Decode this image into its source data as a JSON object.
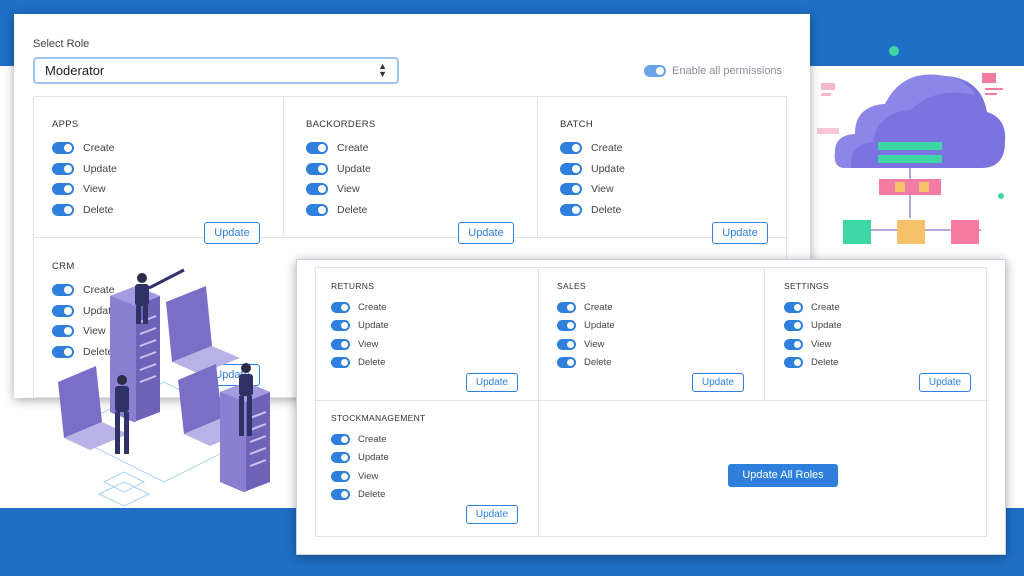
{
  "role_selector": {
    "label": "Select Role",
    "selected": "Moderator"
  },
  "enable_all": {
    "label": "Enable all permissions",
    "checked": true
  },
  "permission_labels": [
    "Create",
    "Update",
    "View",
    "Delete"
  ],
  "update_label": "Update",
  "modules_top": [
    {
      "name": "APPS"
    },
    {
      "name": "BACKORDERS"
    },
    {
      "name": "BATCH"
    },
    {
      "name": "CRM"
    }
  ],
  "modules_bottom": [
    {
      "name": "RETURNS"
    },
    {
      "name": "SALES"
    },
    {
      "name": "SETTINGS"
    },
    {
      "name": "STOCKMANAGEMENT"
    }
  ],
  "update_all_label": "Update All Roles",
  "colors": {
    "brand_blue": "#1f6fc5",
    "toggle_on": "#2f7fdd",
    "cloud": "#7b74e0",
    "server": "#6f63b8"
  }
}
